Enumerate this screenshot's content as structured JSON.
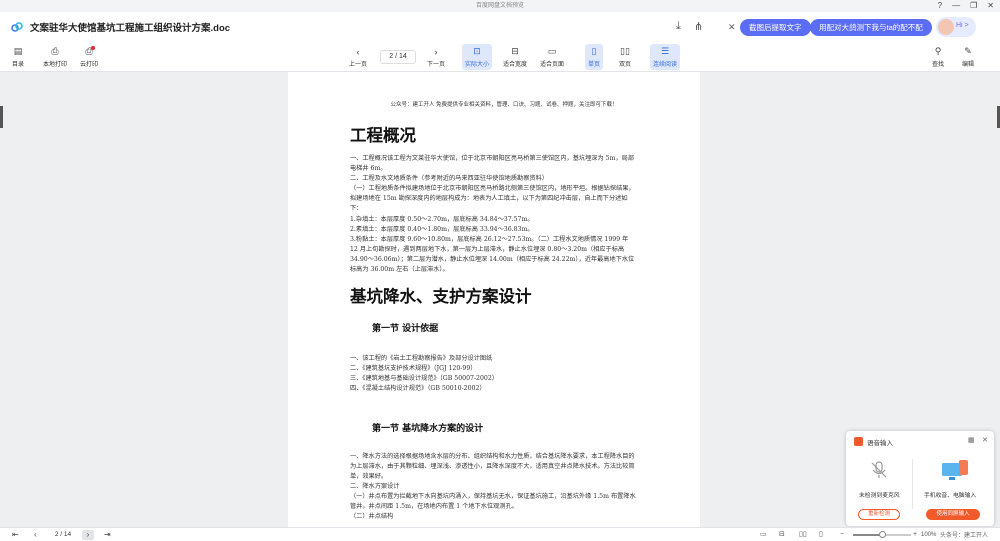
{
  "window": {
    "title": "百度网盘文档预览",
    "controls": [
      "?",
      "—",
      "❐",
      "✕"
    ]
  },
  "doc": {
    "title": "文案驻华大使馆基坑工程施工组织设计方案.doc"
  },
  "ai": {
    "pill1": "截图后提取文字",
    "pill2": "用配对大鸽测下我与ta的配不配",
    "hi": "Hi >"
  },
  "toolbar": {
    "catalog": "目录",
    "local_print": "本地打印",
    "cloud_print": "云打印",
    "prev": "上一页",
    "page_indicator": "2 / 14",
    "next": "下一页",
    "actual_size": "实际大小",
    "fit_width": "适合宽度",
    "fit_page": "适合页面",
    "single": "单页",
    "double": "双页",
    "continuous": "连续阅读",
    "find": "查找",
    "edit": "编辑"
  },
  "content": {
    "banner": "公众号：建工开人  免费提供专业相关资料，管理、口诀、习题、试卷、押题，关注即可下载！",
    "h1a": "工程概况",
    "p1": "一、工程概况该工程为文莱驻华大使馆，位于北京市朝阳区亮马桥第三使馆区内，基坑埋深为 5m，局部电梯井 6m。",
    "p2": "二、工程及水文地质条件（参考附近的马来西亚驻华使馆地质勘察资料）",
    "p3": "（一）工程地质条件拟建场地位于北京市朝阳区亮马桥路北侧第三使馆区内，地形平坦。根据钻探结果，拟建场地在 15m 勘探深度内的地层构成为：地表为人工填土，以下为第四纪冲击层，自上而下分述如下：",
    "p4": "1.杂填土：本层厚度 0.50～2.70m，层底标高 34.84～37.57m。",
    "p5": "2.素填土：本层厚度 0.40～1.80m，层底标高 33.94～36.83m。",
    "p6": "3.粉黏土：本层厚度 9.60～10.80m，层底标高 26.12～27.53m。（二）工程水文地质情况 1999 年 12 月上旬勘探时，遇到两层地下水，第一层为上层滞水，静止水位埋深 0.80～3.20m（相应于标高 34.90～36.06m）；第二层为潜水，静止水位埋深 14.00m（相应于标高 24.22m），近年最高地下水位标高为 36.00m 左右（上层滞水）。",
    "h1b": "基坑降水、支护方案设计",
    "h2a": "第一节 设计依据",
    "p7": "一、该工程的《岩土工程勘察报告》及部分设计图纸",
    "p8": "二、《建筑基坑支护技术规程》（JGJ 120-99）",
    "p9": "三、《建筑地基与基础设计规范》（GB 50007-2002）",
    "p10": "四、《混凝土结构设计规范》（GB 50010-2002）",
    "h2b": "第一节 基坑降水方案的设计",
    "p11": "一、降水方法的选择根据场地含水层的分布、组织结构和水力性质，结合基坑降水要求，本工程降水目的为上层滞水，由于其颗粒细、埋深浅、渗透性小，且降水深度不大，适用真空井点降水技术。方法比较简单，效果好。",
    "p12": "二、降水方案设计",
    "p13": "（一）井点布置为拦截地下水向基坑内涌入，保持基坑无水，保证基坑施工，沿基坑外缘 1.5m 布置降水管井，井点间距 1.5m，在场地内布置 1 个地下水位观测孔。",
    "p14": "（二）井点结构"
  },
  "voice": {
    "title": "语音输入",
    "left_label": "未检测到麦克风",
    "right_label": "手机收音、电脑输入",
    "btn_left": "重新检测",
    "btn_right": "使用同屏输入"
  },
  "status": {
    "page_indicator": "2 / 14",
    "zoom": "100%",
    "zoom_value": 0.5
  },
  "watermark": "头条号：建工开人",
  "icons": [
    "baidu-cloud-logo-icon",
    "download-icon",
    "share-icon",
    "catalog-icon",
    "print-icon",
    "cloud-print-icon",
    "prev-page-icon",
    "next-page-icon",
    "actual-size-icon",
    "fit-width-icon",
    "fit-page-icon",
    "single-page-icon",
    "double-page-icon",
    "continuous-icon",
    "search-icon",
    "edit-icon",
    "mic-off-icon",
    "pc-phone-icon",
    "grid-icon",
    "close-icon"
  ],
  "colors": {
    "accent": "#2f6be0",
    "ai_pill": "#5b6cf5",
    "voice_accent": "#f35a2b",
    "print_dot": "#e22233"
  }
}
